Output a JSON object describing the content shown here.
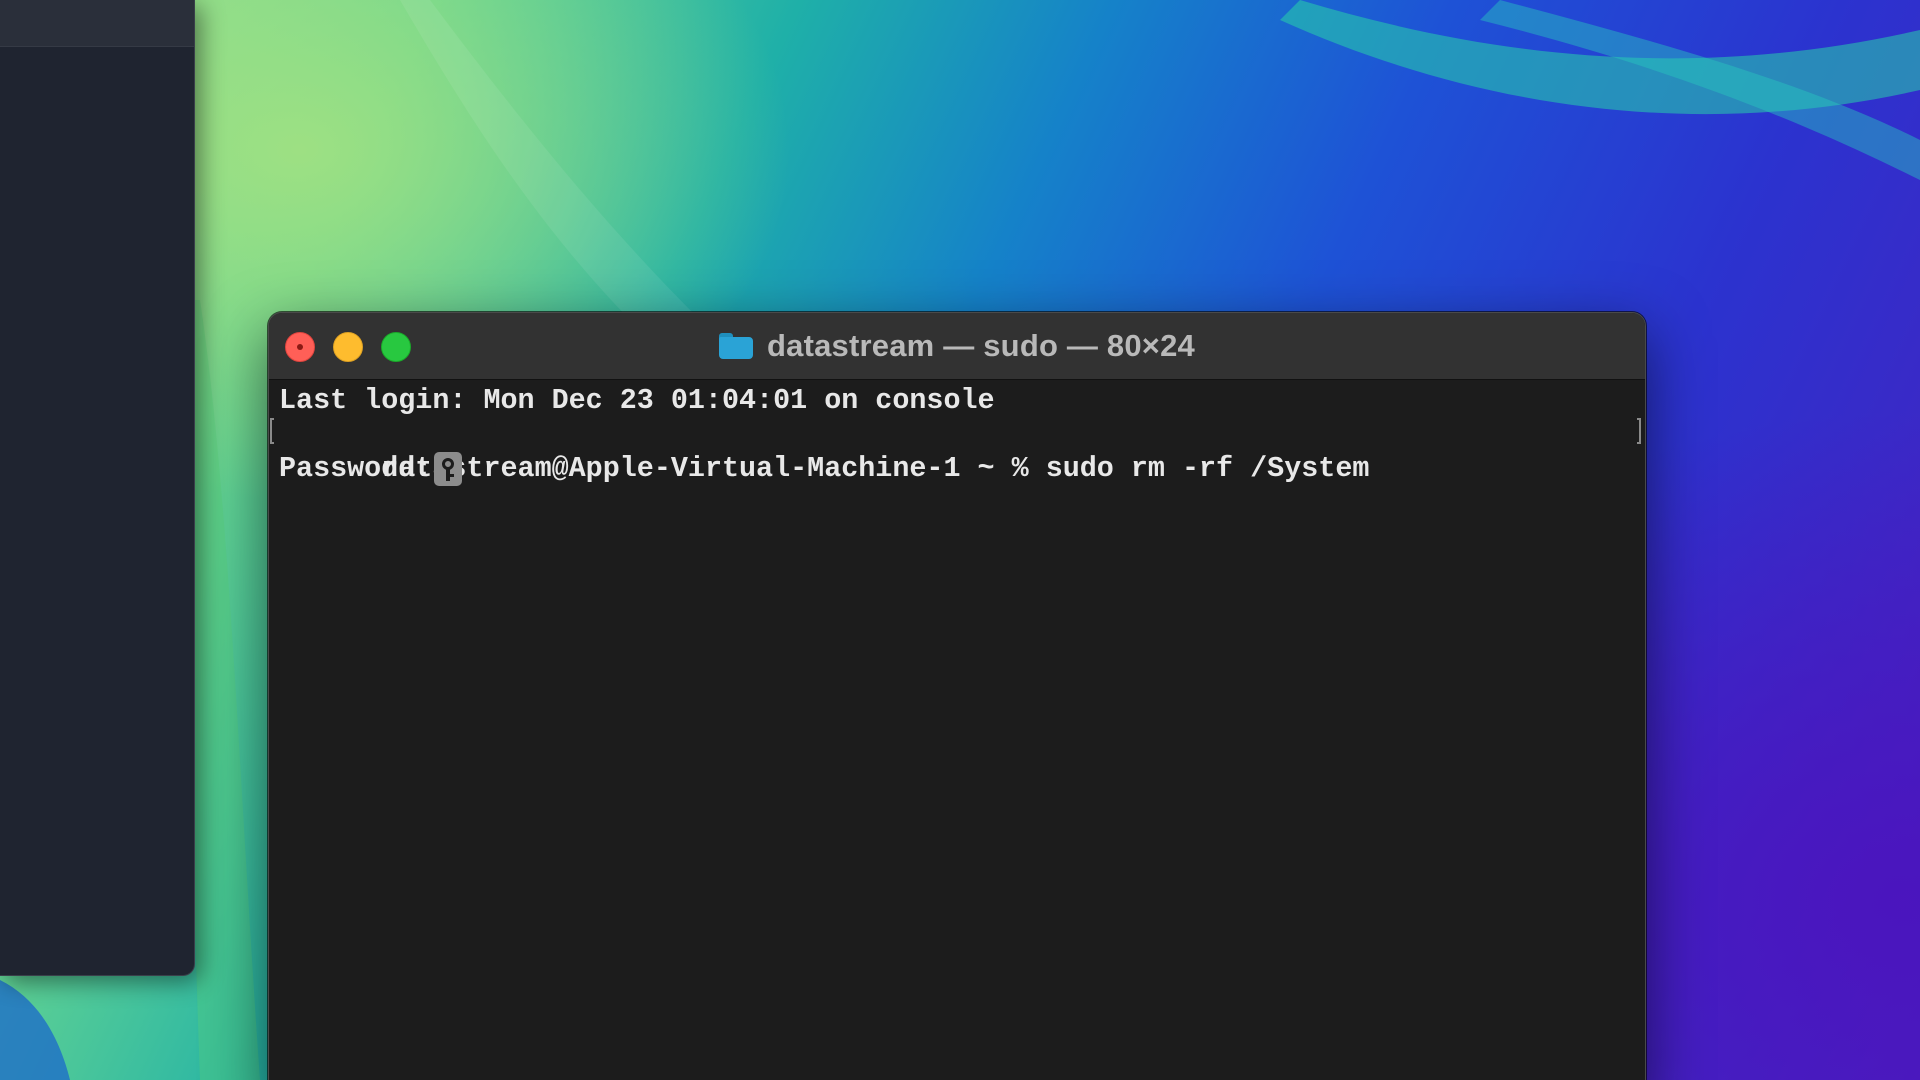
{
  "wallpaper": {
    "colors": [
      "#a3e08d",
      "#1fb0a8",
      "#1e52d6",
      "#4a1fbe"
    ]
  },
  "terminal": {
    "title": "datastream — sudo — 80×24",
    "title_icon": "folder-icon",
    "traffic_lights": {
      "close_color": "#ff5f57",
      "minimize_color": "#febc2e",
      "zoom_color": "#28c840"
    },
    "lines": {
      "last_login": "Last login: Mon Dec 23 01:04:01 on console",
      "prompt": "datastream@Apple-Virtual-Machine-1 ~ % ",
      "command": "sudo rm -rf /System",
      "password_label": "Password:"
    },
    "cursor_icon": "key-icon"
  }
}
